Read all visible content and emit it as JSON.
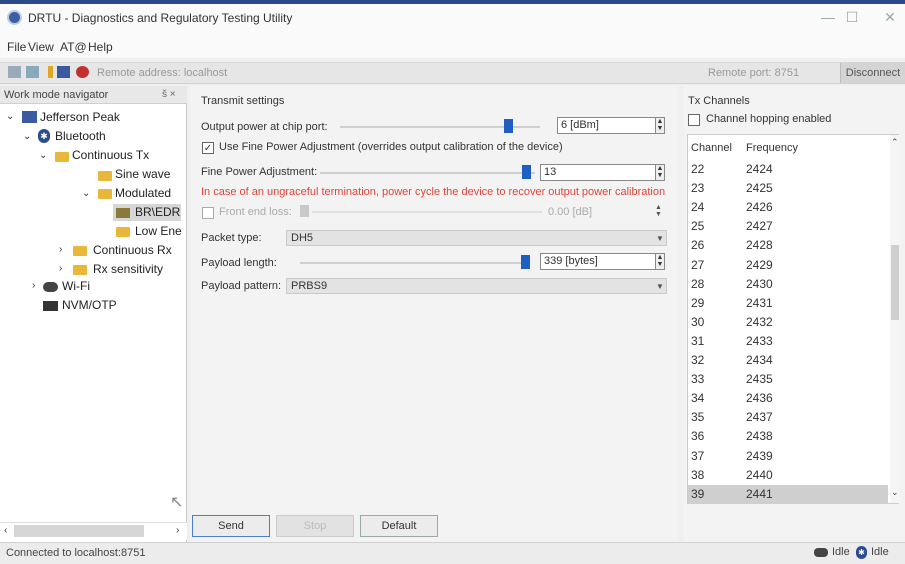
{
  "window": {
    "title": "DRTU - Diagnostics and Regulatory Testing Utility"
  },
  "menu": [
    "File",
    "View",
    "AT@",
    "Help"
  ],
  "toolbar": {
    "remote_address": "Remote address: localhost",
    "remote_port": "Remote port: 8751",
    "disconnect_label": "Disconnect"
  },
  "navigator": {
    "header": "Work mode navigator",
    "header_controls": "š ×",
    "items": [
      {
        "label": "Jefferson Peak"
      },
      {
        "label": "Bluetooth"
      },
      {
        "label": "Continuous Tx"
      },
      {
        "label": "Sine wave"
      },
      {
        "label": "Modulated"
      },
      {
        "label": "BR\\EDR"
      },
      {
        "label": "Low Ene"
      },
      {
        "label": "Continuous Rx"
      },
      {
        "label": "Rx sensitivity"
      },
      {
        "label": "Wi-Fi"
      },
      {
        "label": "NVM/OTP"
      }
    ]
  },
  "transmit": {
    "title": "Transmit settings",
    "output_power_label": "Output power at chip port:",
    "output_power_value": "6 [dBm]",
    "output_power_slider": 0.84,
    "use_fine_label": "Use Fine Power Adjustment (overrides output calibration of the device)",
    "use_fine_checked": true,
    "fine_label": "Fine Power Adjustment:",
    "fine_value": "13",
    "fine_slider": 0.96,
    "warning": "In case of an ungraceful termination, power cycle the device to recover output power calibration",
    "front_end_loss_label": "Front end loss:",
    "front_end_loss_value": "0.00 [dB]",
    "front_end_loss_checked": false,
    "packet_type_label": "Packet type:",
    "packet_type_value": "DH5",
    "payload_length_label": "Payload length:",
    "payload_length_value": "339 [bytes]",
    "payload_length_slider": 1.0,
    "payload_pattern_label": "Payload pattern:",
    "payload_pattern_value": "PRBS9",
    "buttons": {
      "send": "Send",
      "stop": "Stop",
      "default": "Default"
    }
  },
  "tx_channels": {
    "title": "Tx Channels",
    "hopping_label": "Channel hopping enabled",
    "hopping_checked": false,
    "col_channel": "Channel",
    "col_frequency": "Frequency",
    "rows": [
      {
        "channel": "22",
        "frequency": "2424"
      },
      {
        "channel": "23",
        "frequency": "2425"
      },
      {
        "channel": "24",
        "frequency": "2426"
      },
      {
        "channel": "25",
        "frequency": "2427"
      },
      {
        "channel": "26",
        "frequency": "2428"
      },
      {
        "channel": "27",
        "frequency": "2429"
      },
      {
        "channel": "28",
        "frequency": "2430"
      },
      {
        "channel": "29",
        "frequency": "2431"
      },
      {
        "channel": "30",
        "frequency": "2432"
      },
      {
        "channel": "31",
        "frequency": "2433"
      },
      {
        "channel": "32",
        "frequency": "2434"
      },
      {
        "channel": "33",
        "frequency": "2435"
      },
      {
        "channel": "34",
        "frequency": "2436"
      },
      {
        "channel": "35",
        "frequency": "2437"
      },
      {
        "channel": "36",
        "frequency": "2438"
      },
      {
        "channel": "37",
        "frequency": "2439"
      },
      {
        "channel": "38",
        "frequency": "2440"
      },
      {
        "channel": "39",
        "frequency": "2441"
      }
    ],
    "selected_channel": "39"
  },
  "status": {
    "left": "Connected to localhost:8751",
    "wifi_state": "Idle",
    "bt_state": "Idle"
  }
}
